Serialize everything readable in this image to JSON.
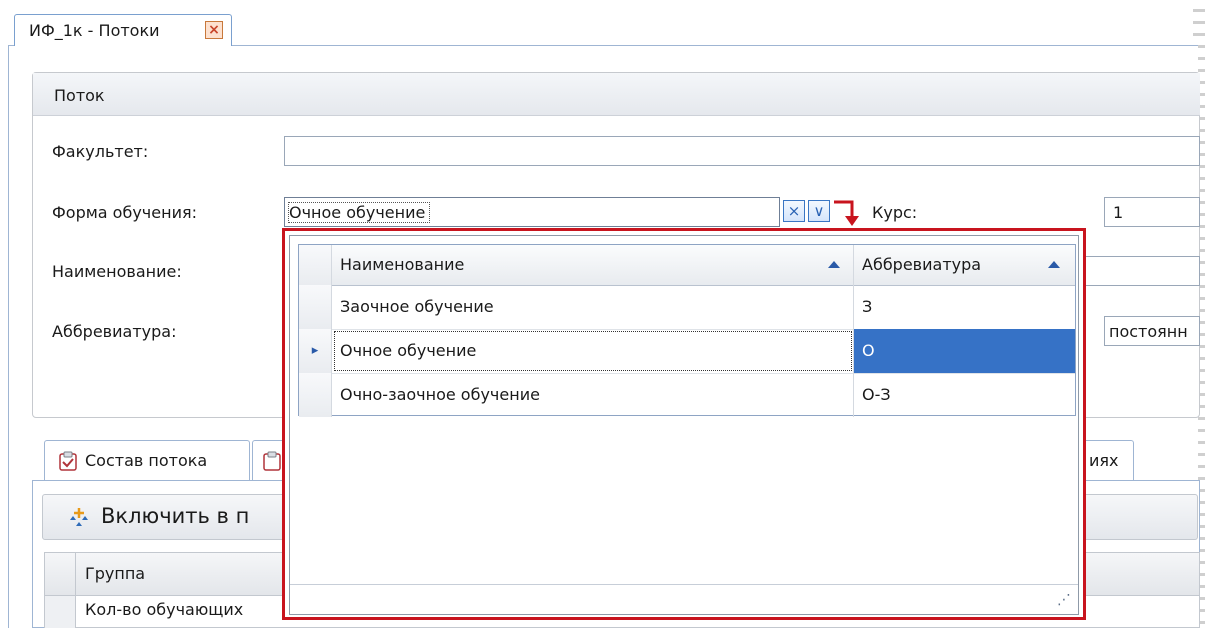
{
  "window": {
    "tab_title": "ИФ_1к - Потоки",
    "tab_close_icon": "×"
  },
  "group": {
    "title": "Поток"
  },
  "form": {
    "faculty_label": "Факультет:",
    "faculty_value": "",
    "study_form_label": "Форма обучения:",
    "study_form_value": "Очное обучение",
    "clear_glyph": "×",
    "dropdown_glyph": "∨",
    "course_label": "Курс:",
    "course_value": "1",
    "name_label": "Наименование:",
    "abbr_label": "Аббревиатура:",
    "type_value_partial": "постоянн"
  },
  "popup": {
    "columns": [
      "Наименование",
      "Аббревиатура"
    ],
    "rows": [
      {
        "name": "Заочное обучение",
        "abbr": "З",
        "current": false
      },
      {
        "name": "Очное обучение",
        "abbr": "О",
        "current": true
      },
      {
        "name": "Очно-заочное обучение",
        "abbr": "О-З",
        "current": false
      }
    ],
    "row_pointer_glyph": "▸",
    "resize_grip_glyph": "⋰"
  },
  "lower_tabs": {
    "tab1_label": "Состав потока",
    "tab_last_partial": "иях"
  },
  "toolbar": {
    "include_button_partial": "Включить в п"
  },
  "lower_grid": {
    "header_col1": "Группа",
    "row1_col1": "Кол-во обучающих"
  },
  "colors": {
    "accent_blue": "#3672c6",
    "popup_border_red": "#c8141e",
    "frame_blue": "#9fb5d3"
  }
}
